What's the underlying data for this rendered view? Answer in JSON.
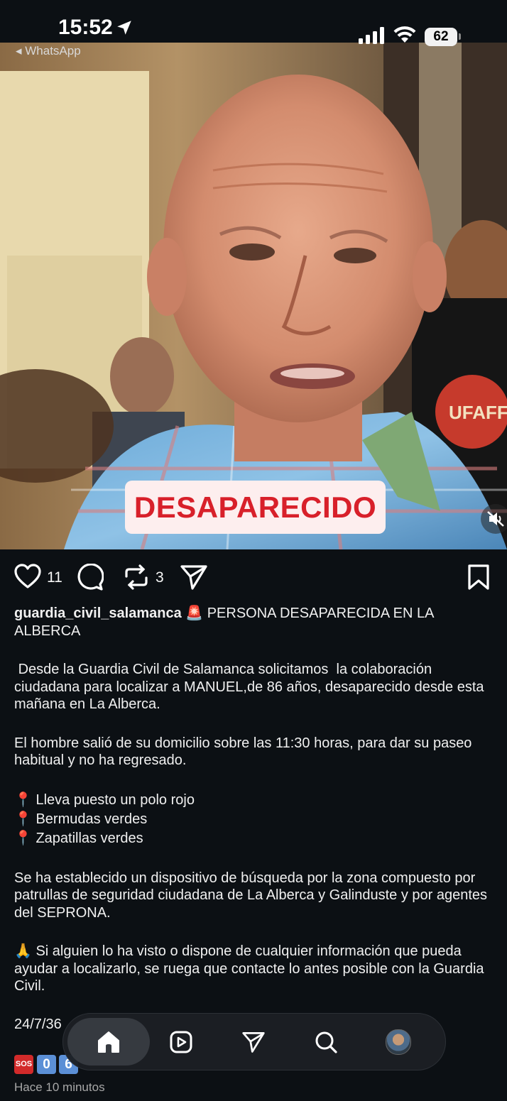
{
  "status_bar": {
    "time": "15:52",
    "back_app": "◂ WhatsApp",
    "battery": "62"
  },
  "post": {
    "overlay_text": "DESAPARECIDO",
    "likes": "11",
    "reposts": "3",
    "username": "guardia_civil_salamanca",
    "title": " 🚨 PERSONA DESAPARECIDA EN LA ALBERCA",
    "paragraphs": [
      " Desde la Guardia Civil de Salamanca solicitamos  la colaboración ciudadana para localizar a MANUEL,de 86 años, desaparecido desde esta mañana en La Alberca.",
      "El hombre salió de su domicilio sobre las 11:30 horas, para dar su paseo habitual y no ha regresado."
    ],
    "bullets": [
      "📍 Lleva puesto un polo rojo",
      "📍 Bermudas verdes",
      "📍 Zapatillas verdes"
    ],
    "paragraph_search": "Se ha establecido un dispositivo de búsqueda por la zona compuesto por patrullas de seguridad ciudadana de La Alberca y Galinduste y por agentes del SEPRONA.",
    "paragraph_help": "🙏 Si alguien lo ha visto o dispone de cualquier información que pueda ayudar a localizarlo, se ruega que contacte lo antes posible con la Guardia Civil.",
    "date_line": "24/7/36",
    "emoji_keys": [
      "SOS",
      "0",
      "6"
    ],
    "time_ago": "Hace 10 minutos"
  },
  "colors": {
    "background": "#0c1014",
    "banner_text": "#d8202a",
    "banner_bg": "#fdeeee"
  },
  "icons": [
    "location-arrow-icon",
    "signal-icon",
    "wifi-icon",
    "battery-icon",
    "mute-icon",
    "heart-icon",
    "comment-icon",
    "repost-icon",
    "send-icon",
    "bookmark-icon",
    "home-icon",
    "reels-icon",
    "search-icon",
    "profile-avatar"
  ]
}
